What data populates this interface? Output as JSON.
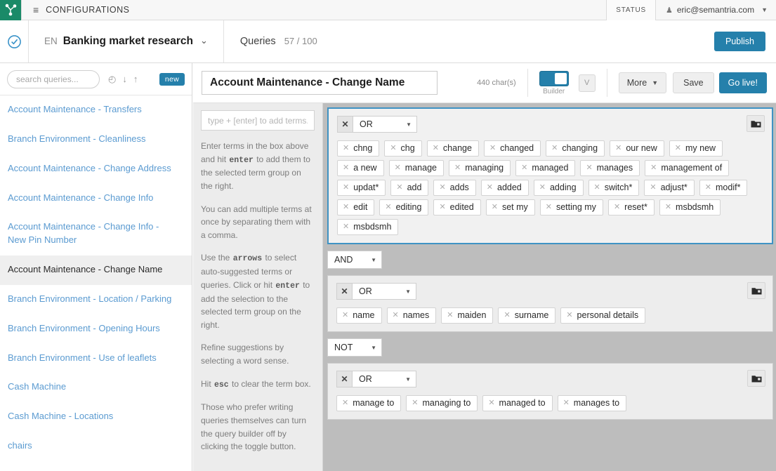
{
  "topbar": {
    "logo_icon": "graph-node-logo",
    "menu_icon": "hamburger-icon",
    "menu_glyph": "≡",
    "section_label": "CONFIGURATIONS",
    "status_label": "STATUS",
    "user_icon": "person-icon",
    "user_glyph": "♟",
    "user_email": "eric@semantria.com",
    "user_caret": "▼"
  },
  "secondbar": {
    "clock_icon": "clock-check-icon",
    "language": "EN",
    "config_name": "Banking market research",
    "config_caret": "⌄",
    "queries_label": "Queries",
    "queries_count": "57 / 100",
    "publish_label": "Publish",
    "accent_color": "#2580ab"
  },
  "sidebar": {
    "search_placeholder": "search queries...",
    "icons": [
      {
        "name": "clock-icon",
        "glyph": "◴"
      },
      {
        "name": "download-arrow-icon",
        "glyph": "↓"
      },
      {
        "name": "upload-arrow-icon",
        "glyph": "↑"
      }
    ],
    "new_badge": "new",
    "queries": [
      {
        "label": "Account Maintenance - Transfers",
        "selected": false
      },
      {
        "label": "Branch Environment - Cleanliness",
        "selected": false
      },
      {
        "label": "Account Maintenance - Change Address",
        "selected": false
      },
      {
        "label": "Account Maintenance - Change Info",
        "selected": false
      },
      {
        "label": "Account Maintenance - Change Info - New Pin Number",
        "selected": false
      },
      {
        "label": "Account Maintenance - Change Name",
        "selected": true
      },
      {
        "label": "Branch Environment - Location / Parking",
        "selected": false
      },
      {
        "label": "Branch Environment - Opening Hours",
        "selected": false
      },
      {
        "label": "Branch Environment - Use of leaflets",
        "selected": false
      },
      {
        "label": "Cash Machine",
        "selected": false
      },
      {
        "label": "Cash Machine - Locations",
        "selected": false
      },
      {
        "label": "chairs",
        "selected": false
      }
    ]
  },
  "toolbar": {
    "query_title": "Account Maintenance - Change Name",
    "char_count": "440 char(s)",
    "builder_label": "Builder",
    "builder_on": true,
    "v_button": "V",
    "more_label": "More",
    "more_caret": "▼",
    "save_label": "Save",
    "golive_label": "Go live!"
  },
  "help": {
    "term_input_placeholder": "type + [enter] to add terms...",
    "paragraphs": [
      {
        "id": "p1",
        "parts": [
          {
            "t": "Enter terms in the box above and hit "
          },
          {
            "t": "enter",
            "kbd": true
          },
          {
            "t": " to add them to the selected term group on the right."
          }
        ]
      },
      {
        "id": "p2",
        "parts": [
          {
            "t": "You can add multiple terms at once by separating them with a comma."
          }
        ]
      },
      {
        "id": "p3",
        "parts": [
          {
            "t": "Use the "
          },
          {
            "t": "arrows",
            "kbd": true
          },
          {
            "t": " to select auto-suggested terms or queries. Click or hit "
          },
          {
            "t": "enter",
            "kbd": true
          },
          {
            "t": " to add the selection to the selected term group on the right."
          }
        ]
      },
      {
        "id": "p4",
        "parts": [
          {
            "t": "Refine suggestions by selecting a word sense."
          }
        ]
      },
      {
        "id": "p5",
        "parts": [
          {
            "t": "Hit "
          },
          {
            "t": "esc",
            "kbd": true
          },
          {
            "t": " to clear the term box."
          }
        ]
      },
      {
        "id": "p6",
        "parts": [
          {
            "t": "Those who prefer writing queries themselves can turn the query builder off by clicking the toggle button."
          }
        ]
      }
    ]
  },
  "builder": {
    "close_glyph": "✕",
    "caret_glyph": "▼",
    "folder_icon": "folder-icon",
    "groups": [
      {
        "operator": "OR",
        "active": true,
        "terms": [
          "chng",
          "chg",
          "change",
          "changed",
          "changing",
          "our new",
          "my new",
          "a new",
          "manage",
          "managing",
          "managed",
          "manages",
          "management of",
          "updat*",
          "add",
          "adds",
          "added",
          "adding",
          "switch*",
          "adjust*",
          "modif*",
          "edit",
          "editing",
          "edited",
          "set my",
          "setting my",
          "reset*",
          "msbdsmh",
          "msbdsmh"
        ]
      },
      {
        "operator": "OR",
        "active": false,
        "terms": [
          "name",
          "names",
          "maiden",
          "surname",
          "personal details"
        ]
      },
      {
        "operator": "OR",
        "active": false,
        "terms": [
          "manage to",
          "managing to",
          "managed to",
          "manages to"
        ]
      }
    ],
    "joiners": [
      "AND",
      "NOT"
    ]
  }
}
